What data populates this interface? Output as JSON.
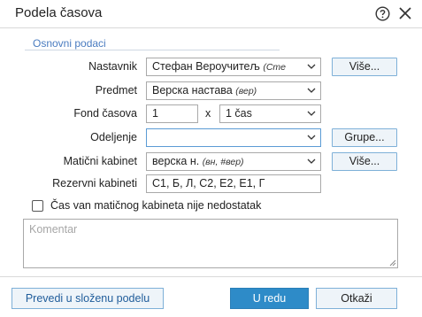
{
  "window": {
    "title": "Podela časova"
  },
  "section": {
    "title": "Osnovni podaci"
  },
  "fields": {
    "nastavnik": {
      "label": "Nastavnik",
      "value": "Стефан Вероучитељ",
      "hint": "(Сте"
    },
    "predmet": {
      "label": "Predmet",
      "value": "Верска настава",
      "hint": "(вер)"
    },
    "fond": {
      "label": "Fond časova",
      "value": "1",
      "times": "x",
      "unit": "1 čas"
    },
    "odeljenje": {
      "label": "Odeljenje",
      "value": ""
    },
    "maticni": {
      "label": "Matični kabinet",
      "value": "верска н.",
      "hint": "(вн, #вер)"
    },
    "rezervni": {
      "label": "Rezervni kabineti",
      "value": "С1, Б, Л, С2, Е2, Е1, Г"
    }
  },
  "buttons": {
    "vise_nastavnik": "Više...",
    "grupe": "Grupe...",
    "vise_kabinet": "Više..."
  },
  "checkbox": {
    "label": "Čas van matičnog kabineta nije nedostatak",
    "checked": false
  },
  "comment": {
    "placeholder": "Komentar"
  },
  "footer": {
    "prevedi": "Prevedi u složenu podelu",
    "ok": "U redu",
    "cancel": "Otkaži"
  },
  "colors": {
    "accent": "#2e8bc8",
    "section_title": "#4a7cc0",
    "button_bg": "#eef4f9",
    "button_border": "#7eb0d8"
  }
}
